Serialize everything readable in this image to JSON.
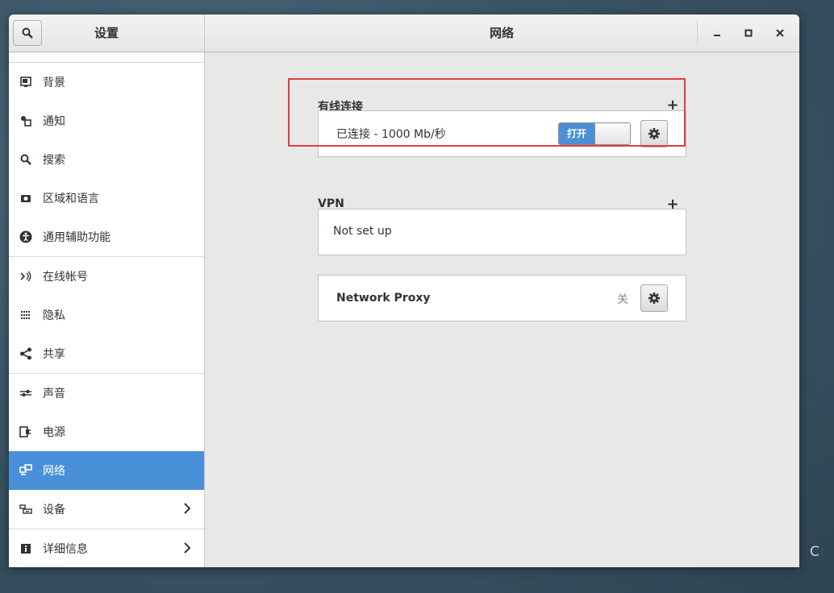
{
  "window": {
    "sidebar_title": "设置",
    "title": "网络",
    "minimize": "_",
    "maximize": "□",
    "close": "✕"
  },
  "sidebar": {
    "items": [
      {
        "label": "背景",
        "icon": "background-icon"
      },
      {
        "label": "通知",
        "icon": "notification-icon"
      },
      {
        "label": "搜索",
        "icon": "search-icon"
      },
      {
        "label": "区域和语言",
        "icon": "region-icon"
      },
      {
        "label": "通用辅助功能",
        "icon": "accessibility-icon"
      },
      {
        "label": "在线帐号",
        "icon": "online-accounts-icon"
      },
      {
        "label": "隐私",
        "icon": "privacy-icon"
      },
      {
        "label": "共享",
        "icon": "share-icon"
      },
      {
        "label": "声音",
        "icon": "sound-icon"
      },
      {
        "label": "电源",
        "icon": "power-icon"
      },
      {
        "label": "网络",
        "icon": "network-icon",
        "active": true
      },
      {
        "label": "设备",
        "icon": "devices-icon"
      },
      {
        "label": "详细信息",
        "icon": "details-icon"
      }
    ]
  },
  "wired": {
    "title": "有线连接",
    "add": "+",
    "status": "已连接 - 1000 Mb/秒",
    "toggle_on": "打开"
  },
  "vpn": {
    "title": "VPN",
    "add": "+",
    "status": "Not set up"
  },
  "proxy": {
    "label": "Network Proxy",
    "status": "关"
  },
  "desktop": {
    "text": "C E"
  },
  "colors": {
    "accent": "#4a90d9",
    "highlight": "#e33c3c"
  }
}
